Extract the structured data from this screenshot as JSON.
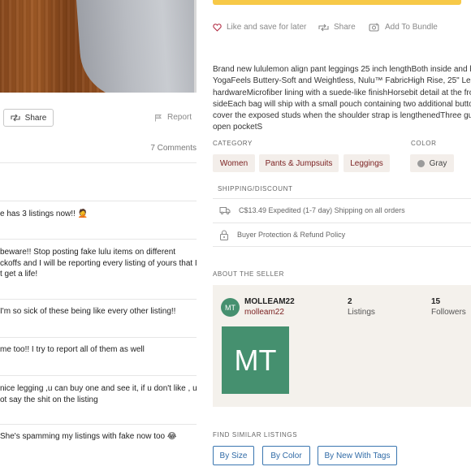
{
  "left": {
    "share_label": "Share",
    "report_label": "Report",
    "comments_count": "7 Comments",
    "comments": [
      "e has 3 listings now!! 🤦",
      "beware!! Stop posting fake lulu items on different\nckoffs and I will be reporting every listing of yours that I\nt get a life!",
      "I'm so sick of these being like every other listing!!",
      "me too!! I try to report all of them as well",
      "nice legging ,u can buy one and see it, if u don't like , u\not say the shit on the listing",
      "She's spamming my listings with fake now too 😂"
    ]
  },
  "actions": {
    "like": "Like and save for later",
    "share": "Share",
    "bundle": "Add To Bundle"
  },
  "description": "Brand new lululemon align pant leggings 25 inch lengthBoth inside and ha\nYogaFeels Buttery-Soft and Weightless, Nulu™ FabricHigh Rise, 25\" Length\nhardwareMicrofiber lining with a suede-like finishHorsebit detail at the fro\nsideEach bag will ship with a small pouch containing two additional butto\ncover the exposed studs when the shoulder strap is lengthenedThree gus\nopen pocketS",
  "category": {
    "label": "Category",
    "chips": [
      "Women",
      "Pants & Jumpsuits",
      "Leggings"
    ]
  },
  "color": {
    "label": "Color",
    "value": "Gray",
    "swatch": "#9b9b9b"
  },
  "shipping": {
    "label": "Shipping/Discount",
    "shipping_text": "C$13.49 Expedited (1-7 day) Shipping on all orders",
    "protection_text": "Buyer Protection & Refund Policy"
  },
  "seller": {
    "section_label": "About the seller",
    "name": "MOLLEAM22",
    "handle": "molleam22",
    "initials": "MT",
    "listings_count": "2",
    "listings_label": "Listings",
    "followers_count": "15",
    "followers_label": "Followers"
  },
  "similar": {
    "label": "Find similar listings",
    "buttons": [
      "By Size",
      "By Color",
      "By New With Tags"
    ]
  },
  "colors": {
    "accent": "#7a1f1f",
    "button_blue": "#2f6aa6",
    "avatar_green": "#45906f",
    "buy_yellow": "#f7c948"
  }
}
